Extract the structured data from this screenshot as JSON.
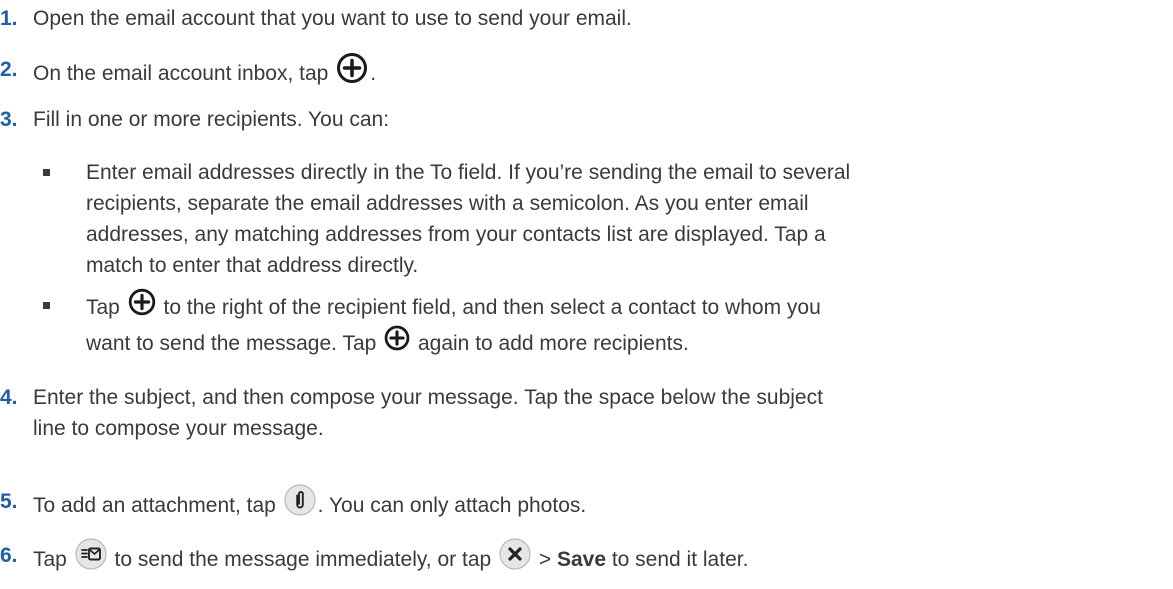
{
  "steps": [
    {
      "num": "1.",
      "text": "Open the email account that you want to use to send your email."
    },
    {
      "num": "2.",
      "text_before": "On the email account inbox, tap ",
      "text_after": "."
    },
    {
      "num": "3.",
      "text": "Fill in one or more recipients. You can:"
    },
    {
      "num": "4.",
      "line1": "Enter the subject, and then compose your message. Tap the space below the subject",
      "line2": "line to compose your message."
    },
    {
      "num": "5.",
      "text_before": "To add an attachment, tap ",
      "text_after": ". You can only attach photos."
    },
    {
      "num": "6.",
      "text_before": "Tap ",
      "text_mid": " to send the message immediately, or tap ",
      "text_gt": " > ",
      "save": "Save",
      "text_after": " to send it later."
    }
  ],
  "bullets": [
    {
      "lines": [
        "Enter email addresses directly in the To field. If you’re sending the email to several",
        "recipients, separate the email addresses with a semicolon. As you enter email",
        "addresses, any matching addresses from your contacts list are displayed. Tap a",
        "match to enter that address directly."
      ]
    },
    {
      "l1_before": "Tap ",
      "l1_after": " to the right of the recipient field, and then select a contact to whom you",
      "l2_before": "want to send the message. Tap ",
      "l2_after": " again to add more recipients."
    }
  ],
  "icons": {
    "add": "plus-circle-icon",
    "attach": "paperclip-icon",
    "send": "send-icon",
    "close": "close-circle-icon"
  }
}
